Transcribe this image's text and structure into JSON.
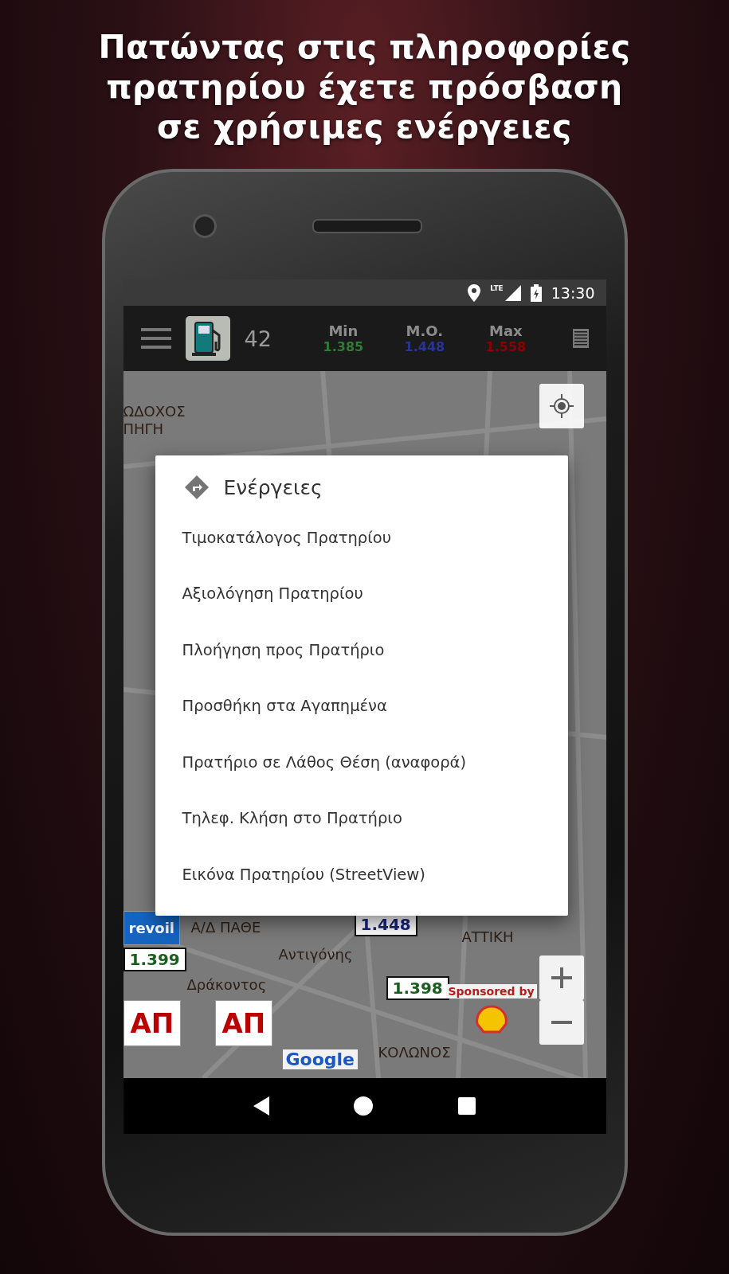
{
  "headline": [
    "Πατώντας στις πληροφορίες",
    "πρατηρίου έχετε πρόσβαση",
    "σε χρήσιμες ενέργειες"
  ],
  "status_bar": {
    "network": "LTE",
    "time": "13:30"
  },
  "toolbar": {
    "count": "42",
    "stats": [
      {
        "label": "Min",
        "value": "1.385",
        "color": "#2e7d32"
      },
      {
        "label": "M.O.",
        "value": "1.448",
        "color": "#283593"
      },
      {
        "label": "Max",
        "value": "1.558",
        "color": "#8b0000"
      }
    ]
  },
  "map": {
    "labels": [
      "ΩΔΟΧΟΣ\nΠΗΓΗ",
      "ΚΟΛΩΝΟΣ",
      "ΑΤΤΙΚΗ",
      "Α/Δ ΠΑΘΕ",
      "Δράκοντος",
      "Αντιγόνης"
    ],
    "brands": [
      "ΑΠ",
      "ΑΠ",
      "revoil"
    ],
    "prices": [
      {
        "price": "1.448",
        "color": "#1a237e"
      },
      {
        "price": "1.398",
        "color": "#1b5e20"
      },
      {
        "price": "1.399",
        "color": "#1b5e20"
      }
    ],
    "sponsor": "Sponsored by",
    "attribution": "Google"
  },
  "dialog": {
    "title": "Ενέργειες",
    "items": [
      "Τιμοκατάλογος Πρατηρίου",
      "Αξιολόγηση Πρατηρίου",
      "Πλοήγηση προς Πρατήριο",
      "Προσθήκη στα Αγαπημένα",
      "Πρατήριο σε Λάθος Θέση (αναφορά)",
      "Τηλεφ. Κλήση στο Πρατήριο",
      "Εικόνα Πρατηρίου (StreetView)"
    ]
  }
}
